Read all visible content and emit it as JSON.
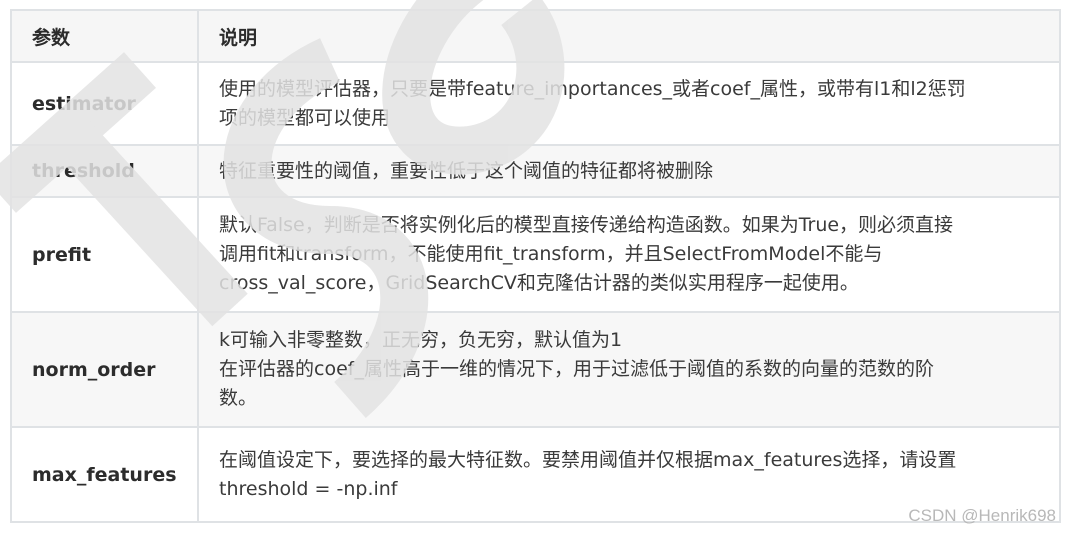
{
  "table": {
    "headers": [
      "参数",
      "说明"
    ],
    "rows": [
      {
        "name": "estimator",
        "desc_lines": [
          "使用的模型评估器，只要是带feature_importances_或者coef_属性，或带有l1和l2惩罚",
          "项的模型都可以使用"
        ]
      },
      {
        "name": "threshold",
        "desc_lines": [
          "特征重要性的阈值，重要性低于这个阈值的特征都将被删除"
        ]
      },
      {
        "name": "prefit",
        "desc_lines": [
          "默认False，判断是否将实例化后的模型直接传递给构造函数。如果为True，则必须直接",
          "调用fit和transform，不能使用fit_transform，并且SelectFromModel不能与",
          "cross_val_score，GridSearchCV和克隆估计器的类似实用程序一起使用。"
        ]
      },
      {
        "name": "norm_order",
        "desc_lines": [
          "k可输入非零整数，正无穷，负无穷，默认值为1",
          "在评估器的coef_属性高于一维的情况下，用于过滤低于阈值的系数的向量的范数的阶",
          "数。"
        ]
      },
      {
        "name": "max_features",
        "desc_lines": [
          "在阈值设定下，要选择的最大特征数。要禁用阈值并仅根据max_features选择，请设置",
          "threshold = -np.inf"
        ]
      }
    ]
  },
  "watermark": {
    "text": "TCSO",
    "color": "#e6e6e6"
  },
  "credit": "CSDN @Henrik698",
  "colors": {
    "border": "#dfe2e5",
    "header_bg": "#f6f6f6",
    "stripe_bg": "#f7f7f7",
    "text": "#333333"
  }
}
